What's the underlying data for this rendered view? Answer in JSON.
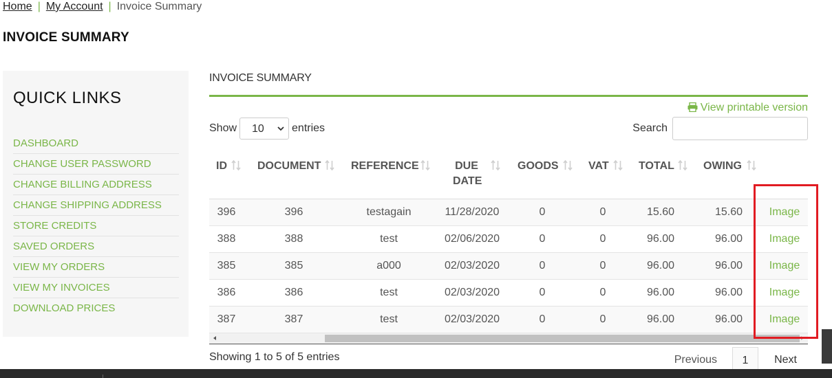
{
  "breadcrumb": {
    "home": "Home",
    "separator": "|",
    "account": "My Account",
    "current": "Invoice Summary"
  },
  "page_title": "INVOICE SUMMARY",
  "sidebar": {
    "title": "QUICK LINKS",
    "items": [
      {
        "label": "DASHBOARD"
      },
      {
        "label": "CHANGE USER PASSWORD"
      },
      {
        "label": "CHANGE BILLING ADDRESS"
      },
      {
        "label": "CHANGE SHIPPING ADDRESS"
      },
      {
        "label": "STORE CREDITS"
      },
      {
        "label": "SAVED ORDERS"
      },
      {
        "label": "VIEW MY ORDERS"
      },
      {
        "label": "VIEW MY INVOICES"
      },
      {
        "label": "DOWNLOAD PRICES"
      }
    ]
  },
  "main": {
    "section_title": "INVOICE SUMMARY",
    "print_link": "View printable version",
    "length": {
      "show": "Show",
      "value": "10",
      "entries": "entries"
    },
    "search": {
      "label": "Search",
      "value": ""
    },
    "columns": [
      "ID",
      "DOCUMENT",
      "REFERENCE",
      "DUE",
      "DATE",
      "GOODS",
      "VAT",
      "TOTAL",
      "OWING"
    ],
    "rows": [
      {
        "id": "396",
        "document": "396",
        "reference": "testagain",
        "due_date": "11/28/2020",
        "goods": "0",
        "vat": "0",
        "total": "15.60",
        "owing": "15.60",
        "link": "Image"
      },
      {
        "id": "388",
        "document": "388",
        "reference": "test",
        "due_date": "02/06/2020",
        "goods": "0",
        "vat": "0",
        "total": "96.00",
        "owing": "96.00",
        "link": "Image"
      },
      {
        "id": "385",
        "document": "385",
        "reference": "a000",
        "due_date": "02/03/2020",
        "goods": "0",
        "vat": "0",
        "total": "96.00",
        "owing": "96.00",
        "link": "Image"
      },
      {
        "id": "386",
        "document": "386",
        "reference": "test",
        "due_date": "02/03/2020",
        "goods": "0",
        "vat": "0",
        "total": "96.00",
        "owing": "96.00",
        "link": "Image"
      },
      {
        "id": "387",
        "document": "387",
        "reference": "test",
        "due_date": "02/03/2020",
        "goods": "0",
        "vat": "0",
        "total": "96.00",
        "owing": "96.00",
        "link": "Image"
      }
    ],
    "info": "Showing 1 to 5 of 5 entries",
    "pagination": {
      "previous": "Previous",
      "current": "1",
      "next": "Next"
    }
  },
  "colors": {
    "accent": "#7ab648",
    "highlight": "#e11b22",
    "footer": "#2a2a2a"
  },
  "icons": {
    "print": "printer-icon",
    "sort": "sort-arrows-icon",
    "select": "chevron-down-icon"
  }
}
